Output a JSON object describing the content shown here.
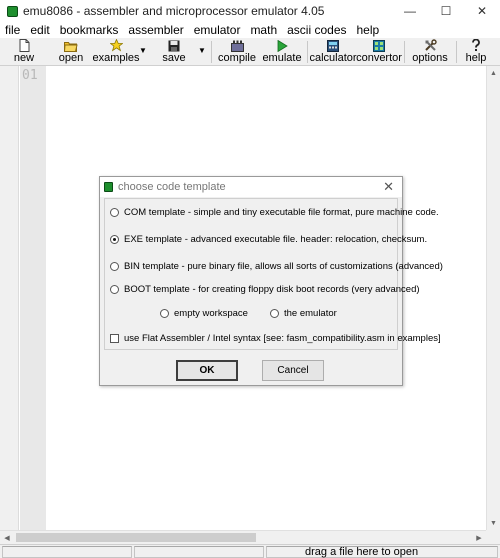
{
  "window": {
    "title": "emu8086 - assembler and microprocessor emulator 4.05",
    "controls": {
      "minimize": "—",
      "maximize": "☐",
      "close": "✕"
    }
  },
  "menu": [
    "file",
    "edit",
    "bookmarks",
    "assembler",
    "emulator",
    "math",
    "ascii codes",
    "help"
  ],
  "toolbar": {
    "new": {
      "label": "new",
      "icon": "new-file-icon"
    },
    "open": {
      "label": "open",
      "icon": "open-folder-icon"
    },
    "examples": {
      "label": "examples",
      "icon": "star-icon"
    },
    "save": {
      "label": "save",
      "icon": "floppy-disk-icon"
    },
    "compile": {
      "label": "compile",
      "icon": "compile-icon"
    },
    "emulate": {
      "label": "emulate",
      "icon": "play-icon"
    },
    "calculator": {
      "label": "calculator",
      "icon": "calculator-icon"
    },
    "convertor": {
      "label": "convertor",
      "icon": "convertor-icon"
    },
    "options": {
      "label": "options",
      "icon": "tools-icon"
    },
    "help": {
      "label": "help",
      "icon": "question-icon"
    }
  },
  "editor": {
    "line_number": "01"
  },
  "status": {
    "text": "drag a file here to open"
  },
  "dialog": {
    "title": "choose code template",
    "options": {
      "com": "COM template - simple and tiny executable file format, pure machine code.",
      "exe": "EXE template - advanced executable file. header: relocation, checksum.",
      "bin": "BIN template - pure binary file, allows all sorts of customizations (advanced)",
      "boot": "BOOT template - for creating floppy disk boot records (very advanced)",
      "empty": "empty workspace",
      "emulator": "the emulator",
      "fasm": "use Flat Assembler / Intel syntax   [see: fasm_compatibility.asm in examples]"
    },
    "selected": "exe",
    "ok": "OK",
    "cancel": "Cancel"
  },
  "colors": {
    "accent_green": "#1e8f2e",
    "editor_bg": "#ffffff",
    "chrome_bg": "#f0f0f0"
  }
}
